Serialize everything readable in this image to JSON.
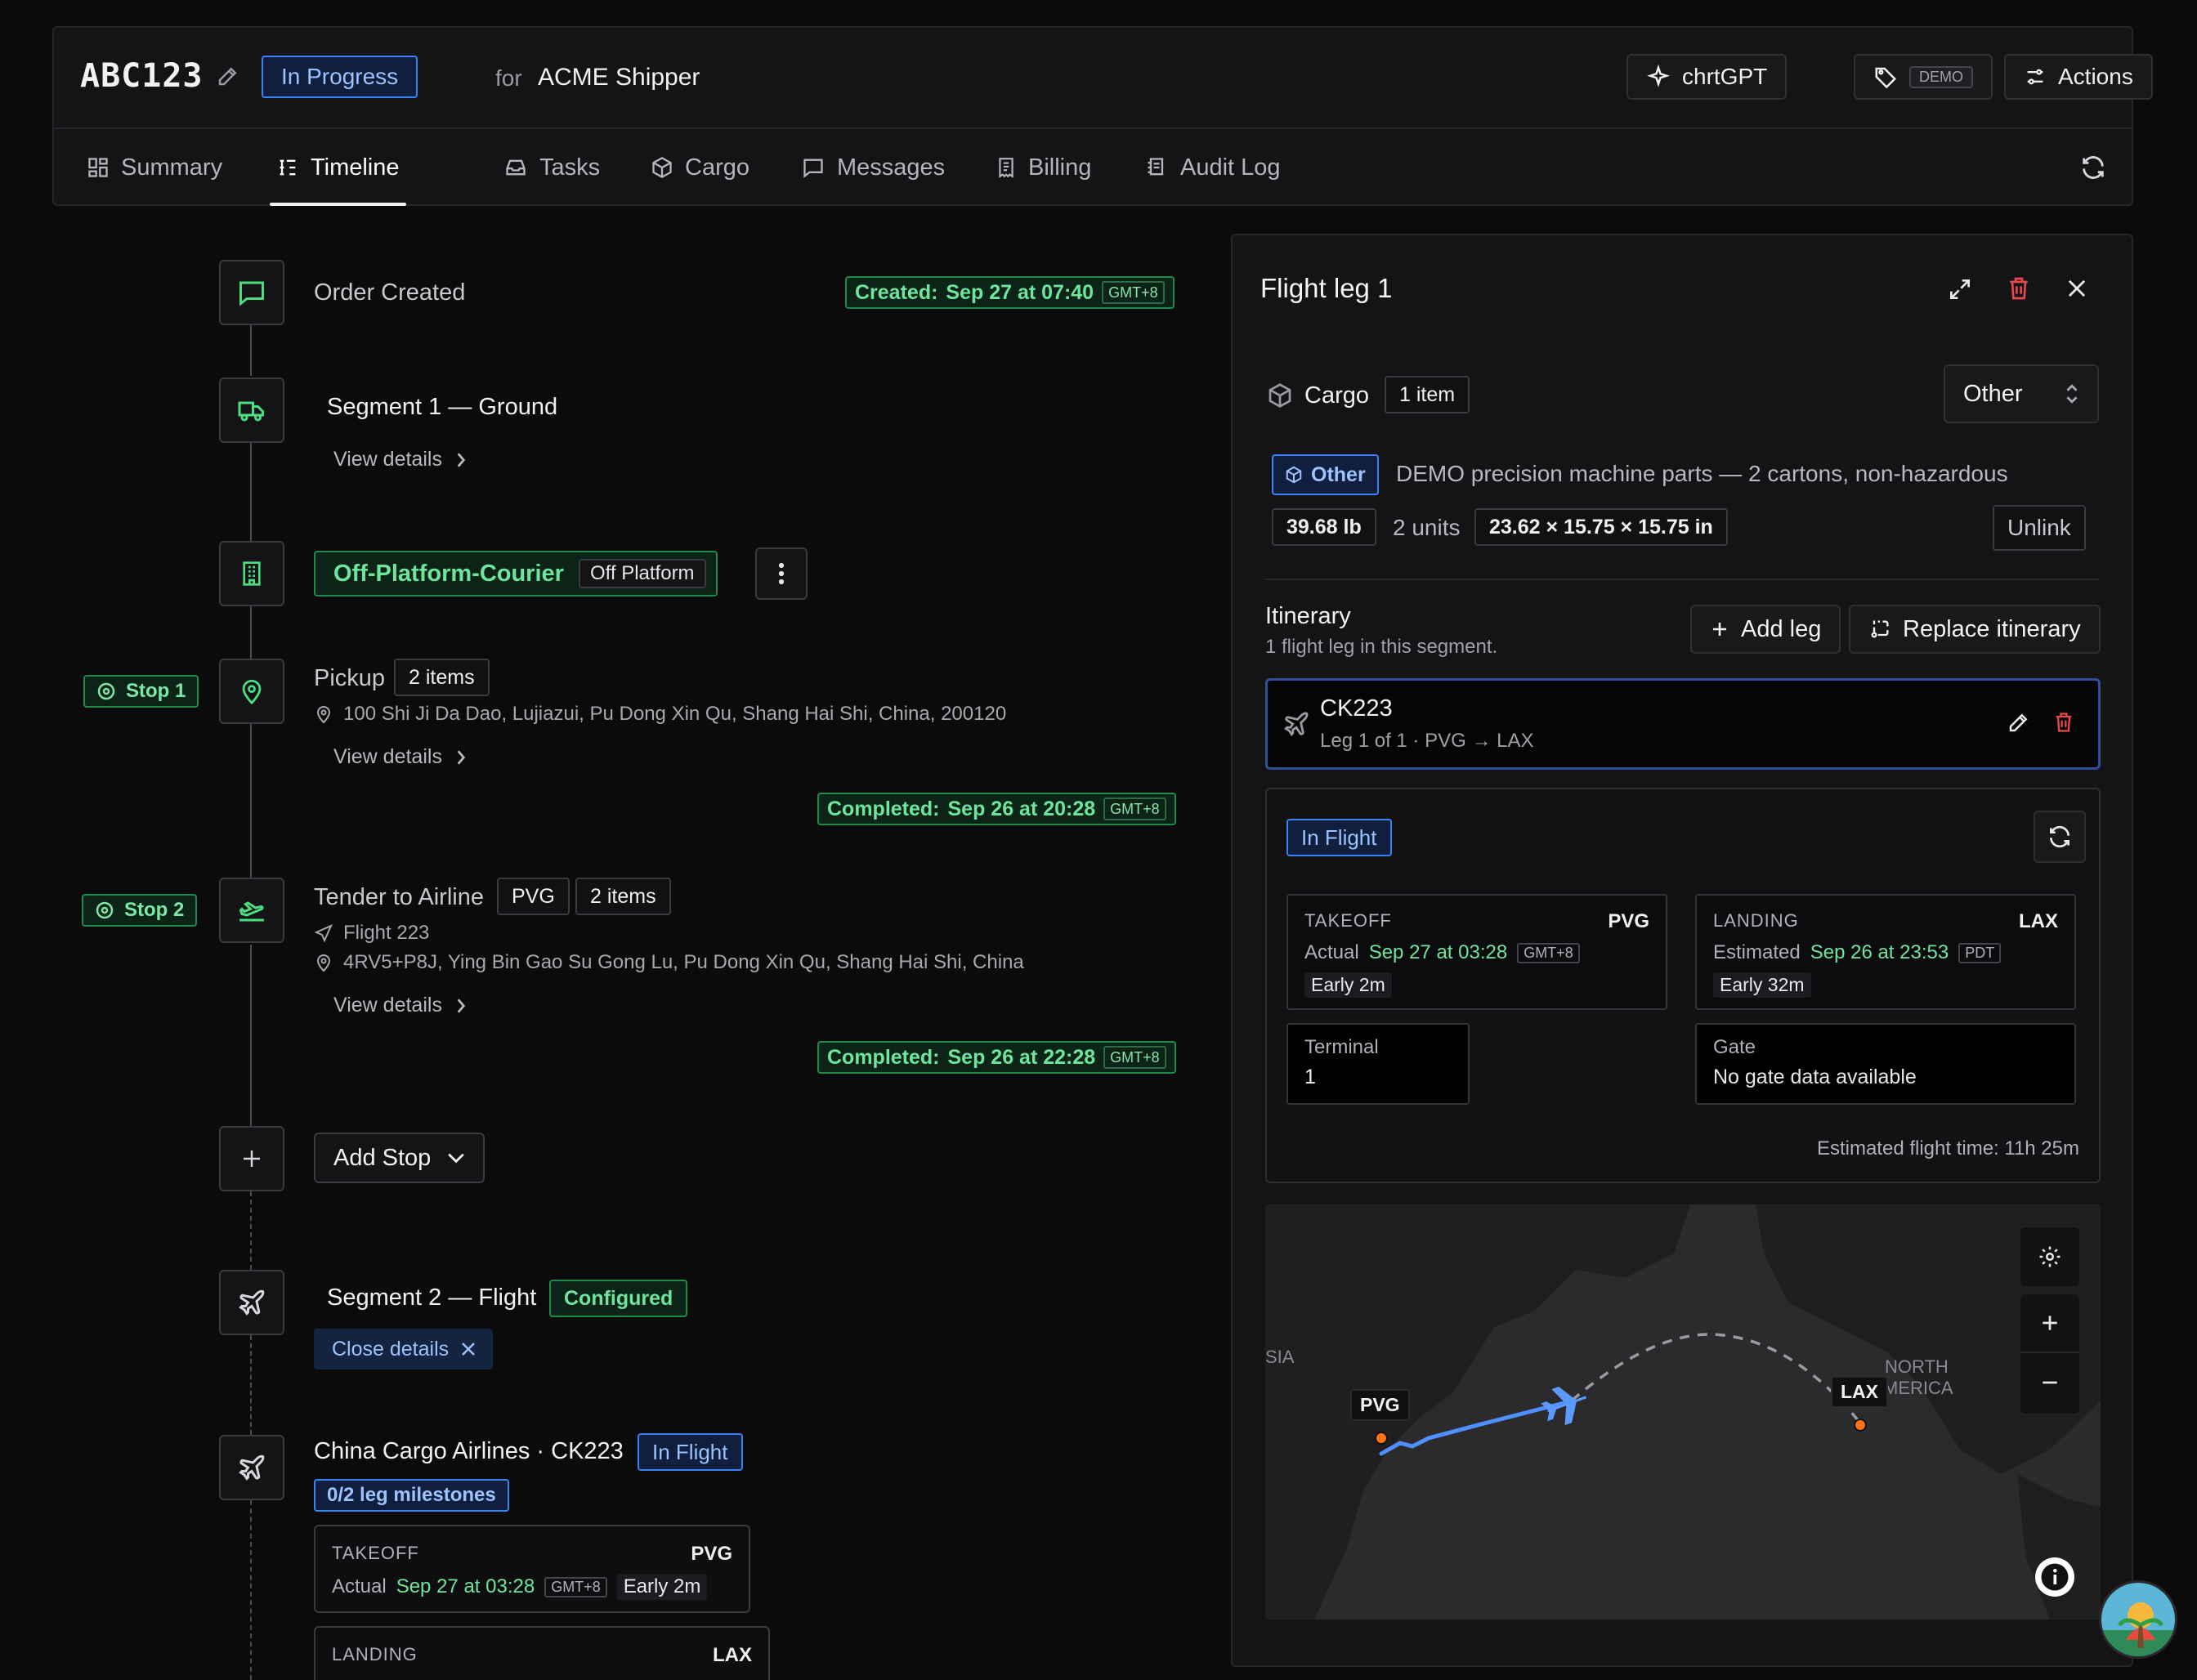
{
  "header": {
    "order_id": "ABC123",
    "status": "In Progress",
    "for_label": "for",
    "shipper": "ACME Shipper",
    "ai_button": "chrtGPT",
    "demo_tag": "DEMO",
    "actions": "Actions"
  },
  "tabs": [
    {
      "label": "Summary",
      "icon": "grid-icon"
    },
    {
      "label": "Timeline",
      "icon": "timeline-icon",
      "active": true
    },
    {
      "label": "Tasks",
      "icon": "inbox-icon"
    },
    {
      "label": "Cargo",
      "icon": "box-icon"
    },
    {
      "label": "Messages",
      "icon": "message-icon"
    },
    {
      "label": "Billing",
      "icon": "receipt-icon"
    },
    {
      "label": "Audit Log",
      "icon": "log-icon"
    }
  ],
  "timeline": {
    "order_created": {
      "title": "Order Created",
      "stamp_label": "Created:",
      "stamp_time": "Sep 27 at 07:40",
      "tz": "GMT+8"
    },
    "segment1": {
      "title": "Segment 1 — Ground",
      "view": "View details"
    },
    "courier": {
      "name": "Off-Platform-Courier",
      "tag": "Off Platform"
    },
    "pickup": {
      "stop": "Stop 1",
      "title": "Pickup",
      "items": "2 items",
      "address": "100 Shi Ji Da Dao, Lujiazui, Pu Dong Xin Qu, Shang Hai Shi, China, 200120",
      "view": "View details",
      "stamp_label": "Completed:",
      "stamp_time": "Sep 26 at 20:28",
      "tz": "GMT+8"
    },
    "tender": {
      "stop": "Stop 2",
      "title": "Tender to Airline",
      "code": "PVG",
      "items": "2 items",
      "flight": "Flight 223",
      "address": "4RV5+P8J, Ying Bin Gao Su Gong Lu, Pu Dong Xin Qu, Shang Hai Shi, China",
      "view": "View details",
      "stamp_label": "Completed:",
      "stamp_time": "Sep 26 at 22:28",
      "tz": "GMT+8"
    },
    "add_stop": "Add Stop",
    "segment2": {
      "title": "Segment 2 — Flight",
      "status": "Configured",
      "close": "Close details"
    },
    "airline": {
      "title": "China Cargo Airlines · CK223",
      "status": "In Flight",
      "milestones": "0/2 leg milestones",
      "takeoff": {
        "caption": "TAKEOFF",
        "code": "PVG",
        "kind": "Actual",
        "time": "Sep 27 at 03:28",
        "tz": "GMT+8",
        "delta": "Early 2m"
      },
      "landing": {
        "caption": "LANDING",
        "code": "LAX"
      }
    }
  },
  "panel": {
    "title": "Flight leg 1",
    "cargo_label": "Cargo",
    "cargo_count": "1 item",
    "cargo_select": "Other",
    "item_tag": "Other",
    "item_desc": "DEMO precision machine parts — 2 cartons, non-hazardous",
    "weight": "39.68 lb",
    "units": "2 units",
    "dims": "23.62 × 15.75 × 15.75 in",
    "unlink": "Unlink",
    "itinerary_title": "Itinerary",
    "itinerary_sub": "1 flight leg in this segment.",
    "add_leg": "Add leg",
    "replace": "Replace itinerary",
    "leg": {
      "code": "CK223",
      "sub": "Leg 1 of 1 · PVG → LAX"
    },
    "status": "In Flight",
    "takeoff": {
      "caption": "TAKEOFF",
      "code": "PVG",
      "kind": "Actual",
      "time": "Sep 27 at 03:28",
      "tz": "GMT+8",
      "delta": "Early 2m"
    },
    "landing": {
      "caption": "LANDING",
      "code": "LAX",
      "kind": "Estimated",
      "time": "Sep 26 at 23:53",
      "tz": "PDT",
      "delta": "Early 32m"
    },
    "terminal": {
      "label": "Terminal",
      "value": "1"
    },
    "gate": {
      "label": "Gate",
      "value": "No gate data available"
    },
    "est_time": "Estimated flight time: 11h 25m",
    "map": {
      "origin": "PVG",
      "dest": "LAX",
      "region_left": "SIA",
      "region_right_1": "NORTH",
      "region_right_2": "MERICA"
    }
  },
  "colors": {
    "accent_green": "#6ee59c",
    "accent_blue": "#3b82f6",
    "danger": "#e5484d",
    "bg": "#0b0b0c"
  }
}
